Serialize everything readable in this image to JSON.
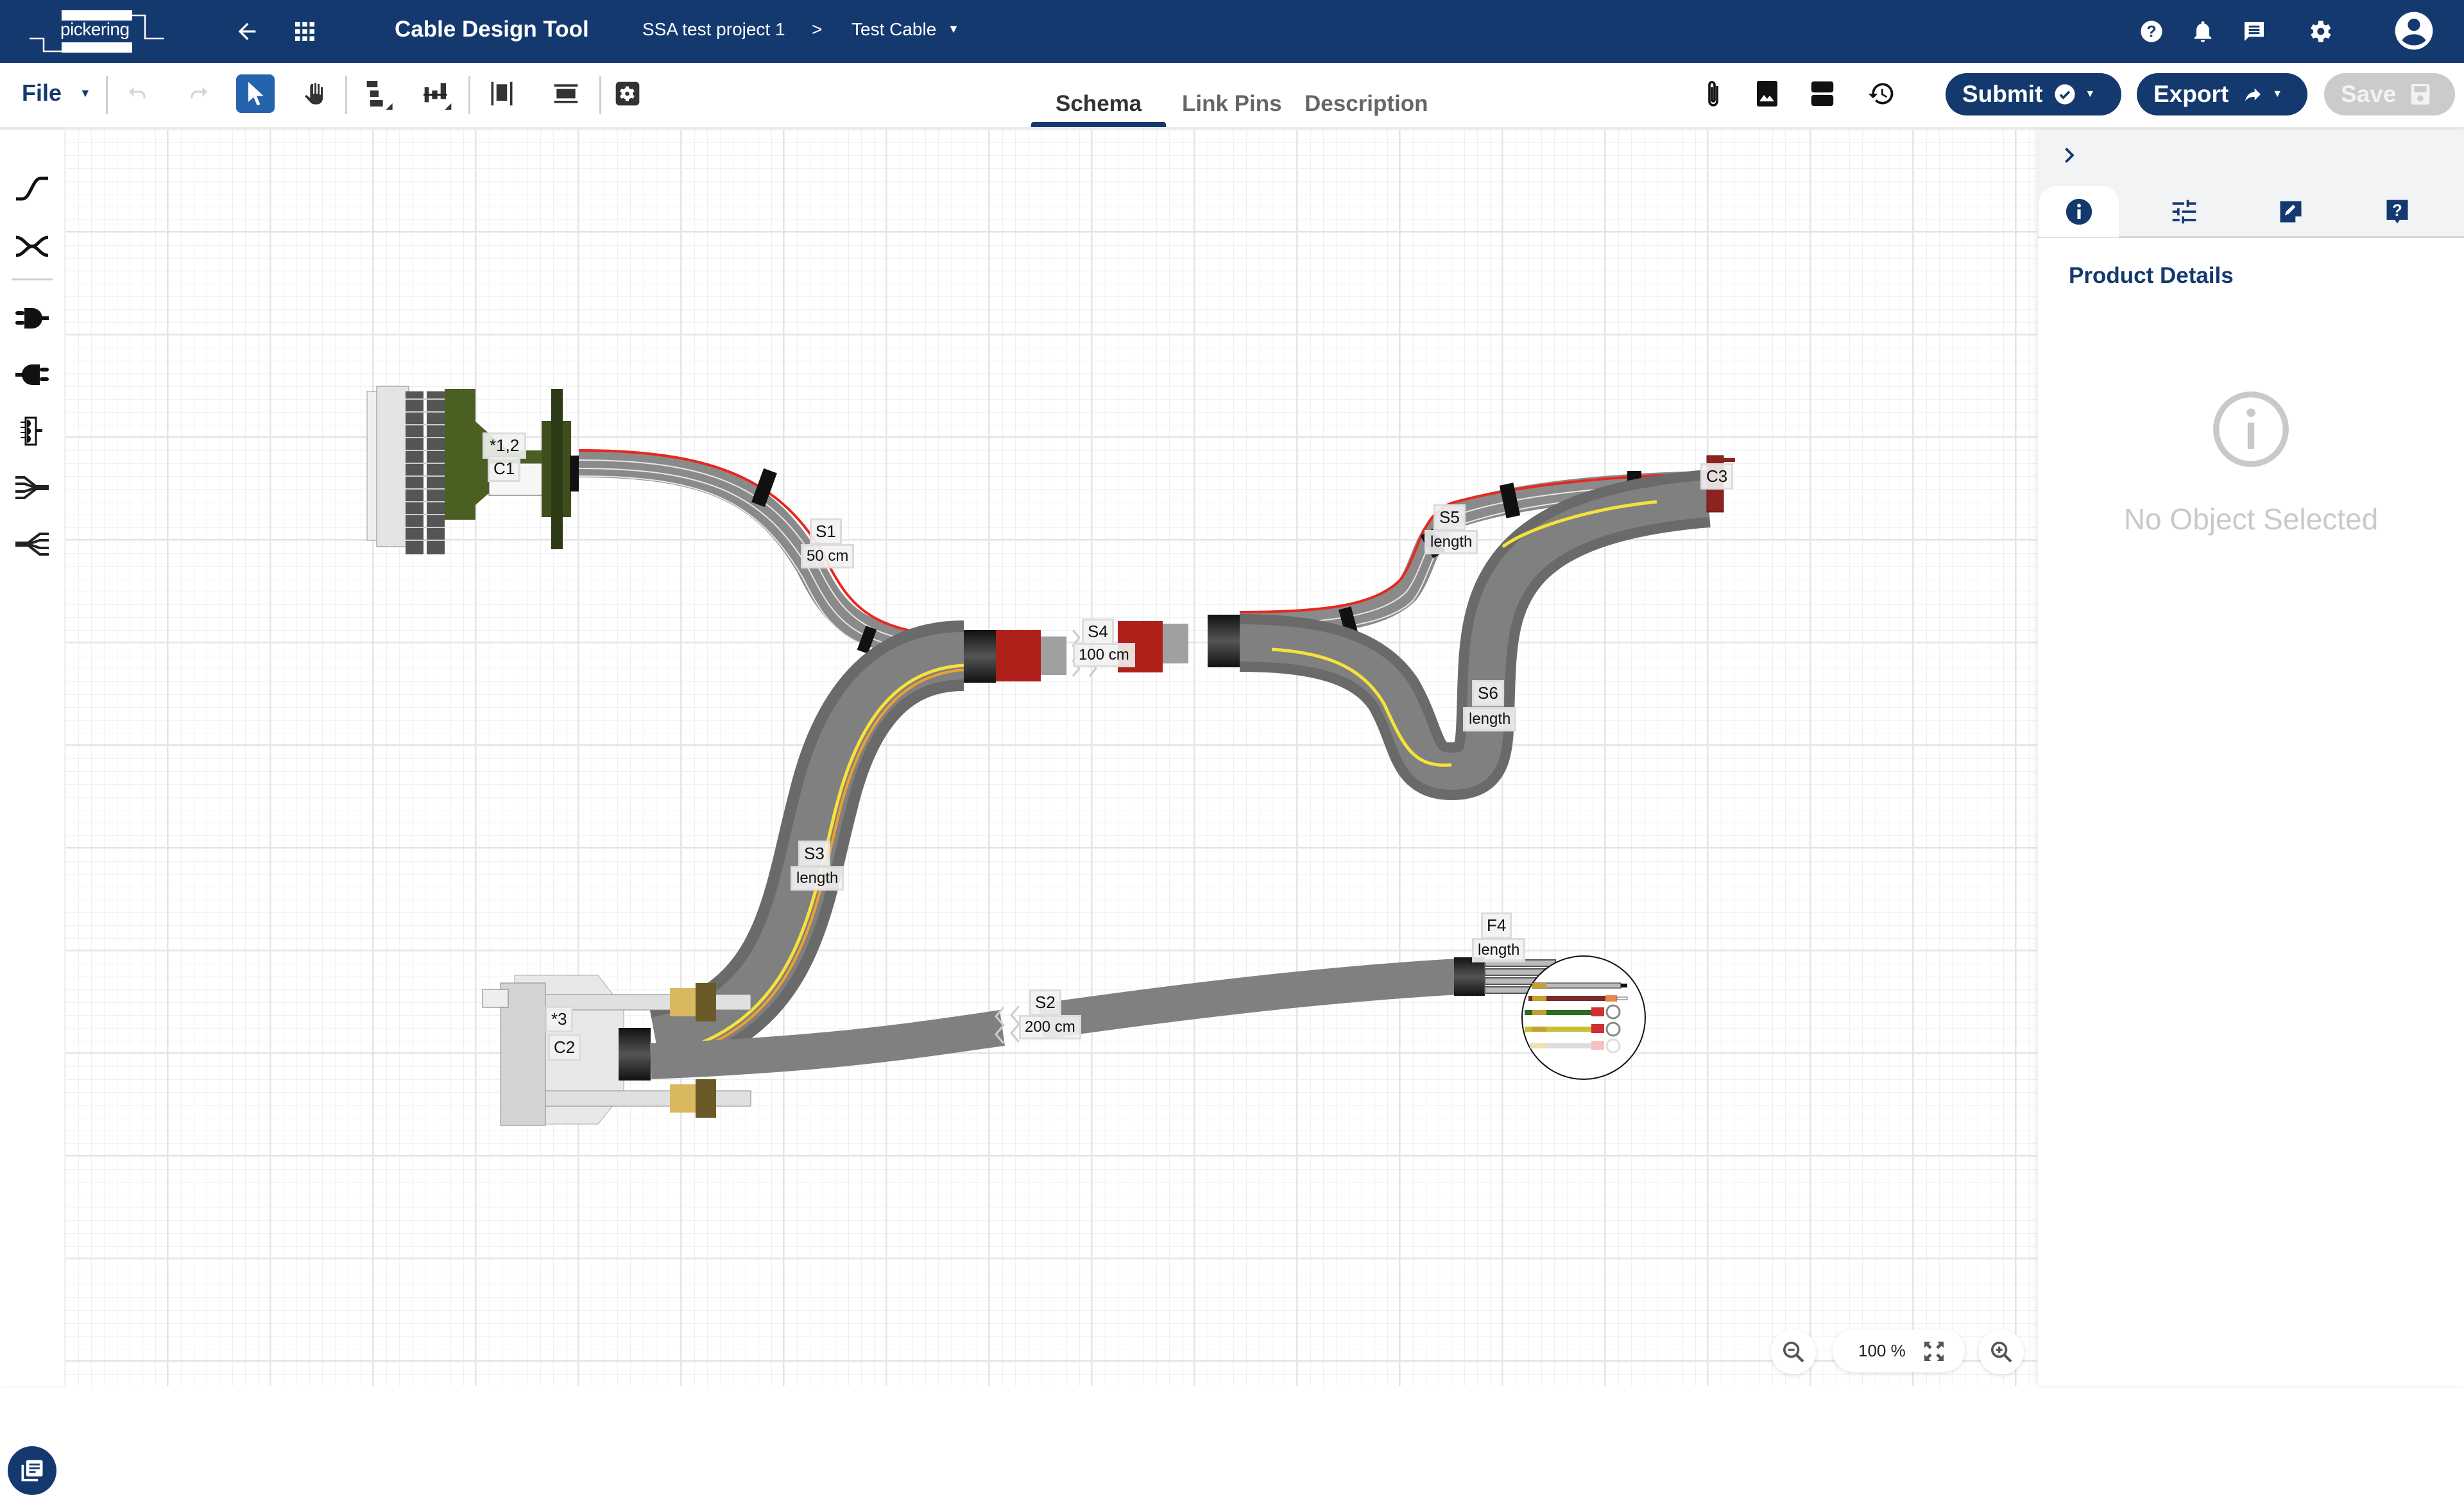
{
  "header": {
    "logo_text": "pickering",
    "app_title": "Cable Design Tool",
    "breadcrumb": {
      "project": "SSA test project 1",
      "separator": ">",
      "cable": "Test Cable"
    },
    "icons": [
      "back-arrow-icon",
      "apps-grid-icon",
      "help-icon",
      "bell-icon",
      "chat-icon",
      "settings-gear-icon",
      "account-icon"
    ]
  },
  "toolbar": {
    "file_label": "File",
    "tools": [
      "undo",
      "redo",
      "select",
      "pan",
      "align-vertical-distribute",
      "align-horizontal-distribute",
      "align-left-right",
      "align-top-bottom",
      "settings"
    ],
    "active_tool": "select",
    "tabs": [
      {
        "label": "Schema",
        "active": true
      },
      {
        "label": "Link Pins",
        "active": false
      },
      {
        "label": "Description",
        "active": false
      }
    ],
    "right_icons": [
      "attachment",
      "image",
      "layout",
      "history"
    ],
    "submit_label": "Submit",
    "export_label": "Export",
    "save_label": "Save",
    "save_enabled": false
  },
  "left_rail": {
    "items": [
      "cable-tool",
      "twist-tool",
      "male-connector",
      "female-connector",
      "terminal-block",
      "breakout-merge",
      "breakout-split"
    ],
    "notes_button": "notes"
  },
  "canvas": {
    "connectors": [
      {
        "id": "C1",
        "note": "*1,2"
      },
      {
        "id": "C2",
        "note": "*3"
      },
      {
        "id": "C3",
        "note": ""
      }
    ],
    "segments": [
      {
        "id": "S1",
        "length": "50 cm"
      },
      {
        "id": "S2",
        "length": "200 cm"
      },
      {
        "id": "S3",
        "length": "length"
      },
      {
        "id": "S4",
        "length": "100 cm"
      },
      {
        "id": "S5",
        "length": "length"
      },
      {
        "id": "S6",
        "length": "length"
      }
    ],
    "fanouts": [
      {
        "id": "F4",
        "length": "length"
      }
    ],
    "colors": {
      "ribbon_red": "#e8281e",
      "cable_gray": "#808080",
      "sleeve_red": "#b0201a",
      "boot_black": "#151515",
      "connector_green": "#4a5f22",
      "yellow_wire": "#f5e23a",
      "orange_wire": "#f0a030"
    }
  },
  "zoom": {
    "value": "100 %"
  },
  "right_panel": {
    "tabs": [
      "info",
      "properties",
      "notes",
      "help"
    ],
    "active_tab": "info",
    "title": "Product Details",
    "empty_message": "No Object Selected"
  },
  "theme": {
    "primary": "#14396f",
    "accent_active_tool": "#2563ad",
    "disabled": "#cbcbcb"
  }
}
